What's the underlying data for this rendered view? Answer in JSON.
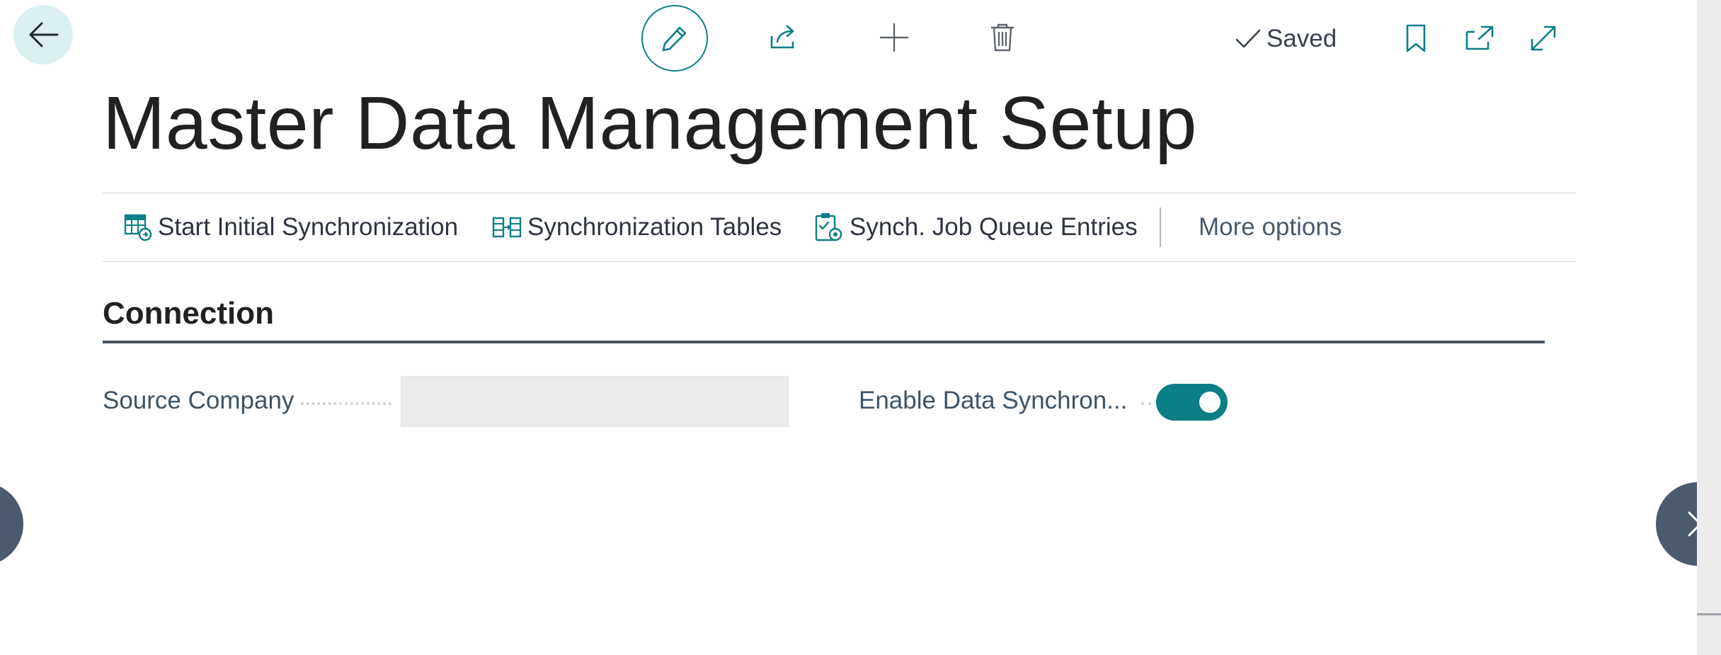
{
  "header": {
    "title": "Master Data Management Setup",
    "saved_label": "Saved"
  },
  "toolbar": {
    "icons": [
      "back-arrow-icon",
      "pencil-icon",
      "share-icon",
      "plus-icon",
      "trash-icon",
      "checkmark-icon",
      "bookmark-icon",
      "popout-icon",
      "expand-icon"
    ]
  },
  "actions": {
    "start_initial_sync": "Start Initial Synchronization",
    "sync_tables": "Synchronization Tables",
    "sync_job_queue": "Synch. Job Queue Entries",
    "more_options": "More options"
  },
  "section": {
    "title": "Connection"
  },
  "fields": {
    "source_company_label": "Source Company",
    "source_company_value": "",
    "enable_sync_label": "Enable Data Synchron...",
    "enable_sync_on": true
  },
  "colors": {
    "accent": "#0b7f86",
    "nav_button": "#4b5a6e",
    "back_button_bg": "#dcf0f2"
  }
}
